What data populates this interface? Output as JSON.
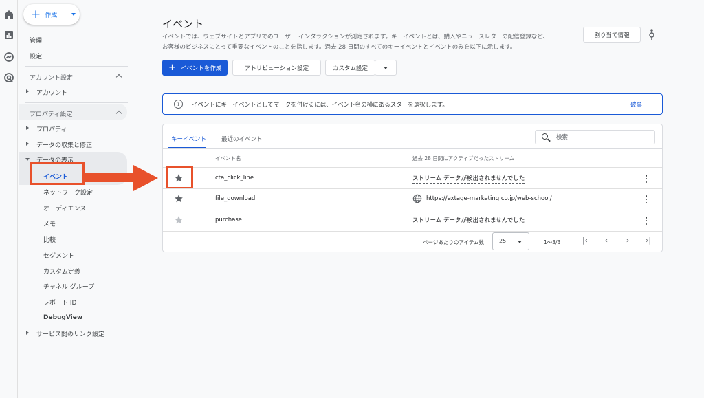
{
  "rail": {
    "icons": [
      "home-icon",
      "bar-chart-icon",
      "explore-icon",
      "advertising-icon"
    ]
  },
  "nav": {
    "create_label": "作成",
    "manage": "管理",
    "settings": "設定",
    "account_section": "アカウント設定",
    "account": "アカウント",
    "property_section": "プロパティ設定",
    "property": "プロパティ",
    "data_collection": "データの収集と修正",
    "data_display": "データの表示",
    "sub_items": [
      "イベント",
      "ネットワーク設定",
      "オーディエンス",
      "メモ",
      "比較",
      "セグメント",
      "カスタム定義",
      "チャネル グループ",
      "レポート ID",
      "DebugView"
    ],
    "service_links": "サービス間のリンク設定"
  },
  "page": {
    "title": "イベント",
    "desc_line1": "イベントでは、ウェブサイトとアプリでのユーザー インタラクションが測定されます。キーイベントとは、購入やニュースレターの配信登録など、",
    "desc_line2": "お客様のビジネスにとって重要なイベントのことを指します。過去 28 日間のすべてのキーイベントとイベントのみを以下に示します。",
    "assign_button": "割り当て情報",
    "create_event_button": "イベントを作成",
    "attribution_button": "アトリビューション設定",
    "custom_button": "カスタム設定"
  },
  "banner": {
    "text": "イベントにキーイベントとしてマークを付けるには、イベント名の横にあるスターを選択します。",
    "dismiss": "破棄"
  },
  "card": {
    "tabs": [
      "キーイベント",
      "最近のイベント"
    ],
    "search_placeholder": "検索",
    "col_event": "イベント名",
    "col_stream": "過去 28 日間にアクティブだったストリーム",
    "rows": [
      {
        "name": "cta_click_line",
        "stream": "ストリーム データが検出されませんでした",
        "starred": true
      },
      {
        "name": "file_download",
        "stream": "https://extage-marketing.co.jp/web-school/",
        "starred": true
      },
      {
        "name": "purchase",
        "stream": "ストリーム データが検出されませんでした",
        "starred": false
      }
    ],
    "pager": {
      "label": "ページあたりのアイテム数:",
      "per_page": "25",
      "range": "1〜3/3"
    }
  },
  "colors": {
    "primary": "#1a5ad7",
    "annotation": "#e8512b",
    "star_active": "#5f6368",
    "star_inactive": "#bdc1c6"
  }
}
